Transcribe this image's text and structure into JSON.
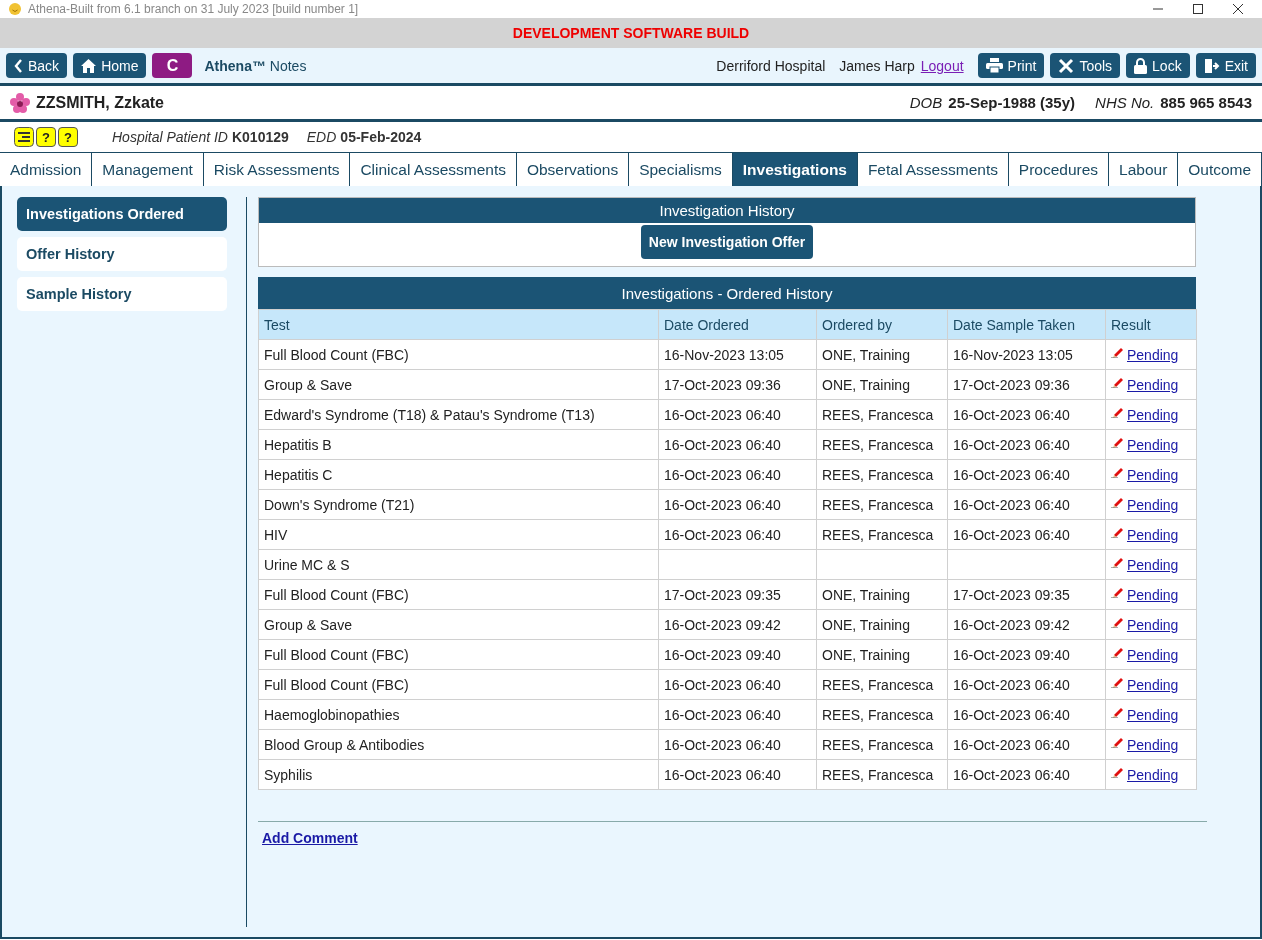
{
  "window": {
    "title": "Athena-Built from 6.1 branch on 31 July 2023 [build number 1]"
  },
  "banner": "DEVELOPMENT SOFTWARE BUILD",
  "toolbar": {
    "left_buttons": [
      {
        "kind": "back",
        "label": "Back"
      },
      {
        "kind": "home",
        "label": "Home"
      },
      {
        "kind": "c",
        "label": "C"
      }
    ],
    "app_name": "Athena™",
    "app_suffix": "Notes",
    "hospital": "Derriford Hospital",
    "user": "James Harp",
    "logout": "Logout",
    "right_buttons": [
      {
        "kind": "print",
        "label": "Print"
      },
      {
        "kind": "tools",
        "label": "Tools"
      },
      {
        "kind": "lock",
        "label": "Lock"
      },
      {
        "kind": "exit",
        "label": "Exit"
      }
    ]
  },
  "patient": {
    "name": "ZZSMITH, Zzkate",
    "dob_label": "DOB",
    "dob": "25-Sep-1988 (35y)",
    "nhs_label": "NHS No.",
    "nhs": "885 965 8543",
    "hospital_id_label": "Hospital Patient ID",
    "hospital_id": "K010129",
    "edd_label": "EDD",
    "edd": "05-Feb-2024",
    "alert_icons": [
      "?",
      "?"
    ]
  },
  "tabs": [
    {
      "label": "Admission",
      "selected": false
    },
    {
      "label": "Management",
      "selected": false
    },
    {
      "label": "Risk Assessments",
      "selected": false
    },
    {
      "label": "Clinical Assessments",
      "selected": false
    },
    {
      "label": "Observations",
      "selected": false
    },
    {
      "label": "Specialisms",
      "selected": false
    },
    {
      "label": "Investigations",
      "selected": true
    },
    {
      "label": "Fetal Assessments",
      "selected": false
    },
    {
      "label": "Procedures",
      "selected": false
    },
    {
      "label": "Labour",
      "selected": false
    },
    {
      "label": "Outcome",
      "selected": false
    }
  ],
  "sidebar": {
    "items": [
      {
        "label": "Investigations Ordered",
        "selected": true
      },
      {
        "label": "Offer History",
        "selected": false
      },
      {
        "label": "Sample History",
        "selected": false
      }
    ]
  },
  "history_panel": {
    "title": "Investigation History",
    "button": "New Investigation Offer"
  },
  "table": {
    "title": "Investigations - Ordered History",
    "columns": [
      "Test",
      "Date Ordered",
      "Ordered by",
      "Date Sample Taken",
      "Result"
    ],
    "rows": [
      {
        "test": "Full Blood Count (FBC)",
        "date_ordered": "16-Nov-2023 13:05",
        "ordered_by": "ONE, Training",
        "date_sample_taken": "16-Nov-2023 13:05",
        "result": "Pending"
      },
      {
        "test": "Group & Save",
        "date_ordered": "17-Oct-2023 09:36",
        "ordered_by": "ONE, Training",
        "date_sample_taken": "17-Oct-2023 09:36",
        "result": "Pending"
      },
      {
        "test": "Edward's Syndrome (T18) & Patau's Syndrome (T13)",
        "date_ordered": "16-Oct-2023 06:40",
        "ordered_by": "REES, Francesca",
        "date_sample_taken": "16-Oct-2023 06:40",
        "result": "Pending"
      },
      {
        "test": "Hepatitis B",
        "date_ordered": "16-Oct-2023 06:40",
        "ordered_by": "REES, Francesca",
        "date_sample_taken": "16-Oct-2023 06:40",
        "result": "Pending"
      },
      {
        "test": "Hepatitis C",
        "date_ordered": "16-Oct-2023 06:40",
        "ordered_by": "REES, Francesca",
        "date_sample_taken": "16-Oct-2023 06:40",
        "result": "Pending"
      },
      {
        "test": "Down's Syndrome (T21)",
        "date_ordered": "16-Oct-2023 06:40",
        "ordered_by": "REES, Francesca",
        "date_sample_taken": "16-Oct-2023 06:40",
        "result": "Pending"
      },
      {
        "test": "HIV",
        "date_ordered": "16-Oct-2023 06:40",
        "ordered_by": "REES, Francesca",
        "date_sample_taken": "16-Oct-2023 06:40",
        "result": "Pending"
      },
      {
        "test": "Urine MC & S",
        "result": "Pending"
      },
      {
        "test": "Full Blood Count (FBC)",
        "date_ordered": "17-Oct-2023 09:35",
        "ordered_by": "ONE, Training",
        "date_sample_taken": "17-Oct-2023 09:35",
        "result": "Pending"
      },
      {
        "test": "Group & Save",
        "date_ordered": "16-Oct-2023 09:42",
        "ordered_by": "ONE, Training",
        "date_sample_taken": "16-Oct-2023 09:42",
        "result": "Pending"
      },
      {
        "test": "Full Blood Count (FBC)",
        "date_ordered": "16-Oct-2023 09:40",
        "ordered_by": "ONE, Training",
        "date_sample_taken": "16-Oct-2023 09:40",
        "result": "Pending"
      },
      {
        "test": "Full Blood Count (FBC)",
        "date_ordered": "16-Oct-2023 06:40",
        "ordered_by": "REES, Francesca",
        "date_sample_taken": "16-Oct-2023 06:40",
        "result": "Pending"
      },
      {
        "test": "Haemoglobinopathies",
        "date_ordered": "16-Oct-2023 06:40",
        "ordered_by": "REES, Francesca",
        "date_sample_taken": "16-Oct-2023 06:40",
        "result": "Pending"
      },
      {
        "test": "Blood Group & Antibodies",
        "date_ordered": "16-Oct-2023 06:40",
        "ordered_by": "REES, Francesca",
        "date_sample_taken": "16-Oct-2023 06:40",
        "result": "Pending"
      },
      {
        "test": "Syphilis",
        "date_ordered": "16-Oct-2023 06:40",
        "ordered_by": "REES, Francesca",
        "date_sample_taken": "16-Oct-2023 06:40",
        "result": "Pending"
      }
    ]
  },
  "add_comment": "Add Comment"
}
